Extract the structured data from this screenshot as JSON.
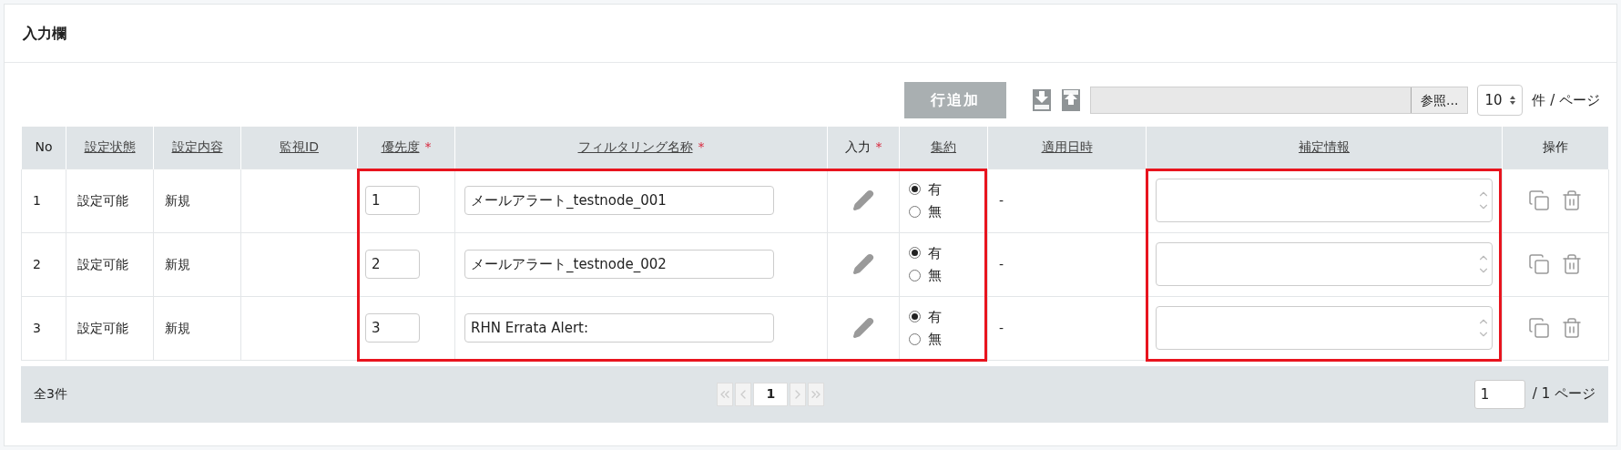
{
  "panel": {
    "title": "入力欄"
  },
  "toolbar": {
    "add_row_button": {
      "label": "行追加",
      "disabled": true
    },
    "file_field": {
      "browse_label": "参照..."
    },
    "page_size": "10",
    "page_size_unit": "件 / ページ"
  },
  "table": {
    "columns": [
      {
        "label": "No",
        "sortable": false,
        "required": false,
        "highlighted": false
      },
      {
        "label": "設定状態",
        "sortable": true,
        "required": false,
        "highlighted": false
      },
      {
        "label": "設定内容",
        "sortable": true,
        "required": false,
        "highlighted": false
      },
      {
        "label": "監視ID",
        "sortable": true,
        "required": false,
        "highlighted": false
      },
      {
        "label": "優先度",
        "sortable": true,
        "required": true,
        "required_mark": "*",
        "highlighted": true
      },
      {
        "label": "フィルタリング名称",
        "sortable": true,
        "required": true,
        "required_mark": "*",
        "highlighted": true
      },
      {
        "label": "入力",
        "sortable": false,
        "required": true,
        "required_mark": "*",
        "highlighted": true
      },
      {
        "label": "集約",
        "sortable": true,
        "required": false,
        "highlighted": true
      },
      {
        "label": "適用日時",
        "sortable": true,
        "required": false,
        "highlighted": false
      },
      {
        "label": "補定情報",
        "sortable": true,
        "required": false,
        "highlighted": true
      },
      {
        "label": "操作",
        "sortable": false,
        "required": false,
        "highlighted": false
      }
    ],
    "rows": [
      {
        "no": "1",
        "status": "設定可能",
        "content": "新規",
        "priority": "1",
        "name": "メールアラート_testnode_001",
        "summary": [
          {
            "label": "有",
            "selected": true
          },
          {
            "label": "無",
            "selected": false
          }
        ],
        "applied": "-"
      },
      {
        "no": "2",
        "status": "設定可能",
        "content": "新規",
        "priority": "2",
        "name": "メールアラート_testnode_002",
        "summary": [
          {
            "label": "有",
            "selected": true
          },
          {
            "label": "無",
            "selected": false
          }
        ],
        "applied": "-"
      },
      {
        "no": "3",
        "status": "設定可能",
        "content": "新規",
        "priority": "3",
        "name": "RHN Errata Alert:",
        "summary": [
          {
            "label": "有",
            "selected": true
          },
          {
            "label": "無",
            "selected": false
          }
        ],
        "applied": "-"
      }
    ]
  },
  "footer": {
    "total": "全3件",
    "pager": {
      "current": "1"
    },
    "page_field": "1",
    "page_suffix": "/ 1 ページ"
  }
}
